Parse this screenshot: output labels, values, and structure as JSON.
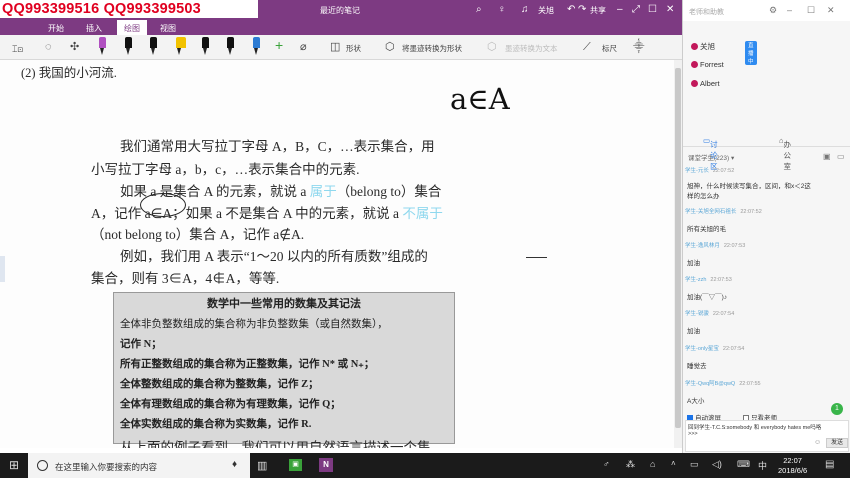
{
  "watermark": "QQ993399516  QQ993399503",
  "window": {
    "title": "最近的笔记",
    "user": "关旭",
    "share_label": "共享",
    "tabs": [
      "开始",
      "插入",
      "绘图",
      "视图"
    ],
    "active_tab": "绘图"
  },
  "ribbon": {
    "shape_label": "形状",
    "ink_to_shape_label": "将墨迹转换为形状",
    "ink_to_text_label": "墨迹转换为文本",
    "ruler_label": "标尺",
    "pen_colors": [
      "#b04fc0",
      "#111111",
      "#111111",
      "#f2c200",
      "#111111",
      "#111111",
      "#2b7bd3",
      "#111111",
      "#3aa23a"
    ]
  },
  "page": {
    "heading": "(2) 我国的小河流.",
    "handwriting": "a∈A",
    "para1_line1": "我们通常用大写拉丁字母 A，B，C，…表示集合，用",
    "para1_line2": "小写拉丁字母 a，b，c，…表示集合中的元素.",
    "para2_line1_a": "如果 a 是集合 A 的元素，就说 a ",
    "para2_line1_hl": "属于",
    "para2_line1_b": "（belong to）集合",
    "para2_line2_a": "A，记作 a∈A；如果 a 不是集合 A 中的元素，就说 a ",
    "para2_line2_hl": "不属于",
    "para2_line3": "（not belong to）集合 A，记作 a∉A.",
    "para3_line1": "例如，我们用 A 表示“1～20 以内的所有质数”组成的",
    "para3_line2": "集合，则有 3∈A，4∉A，等等.",
    "box": {
      "title": "数学中一些常用的数集及其记法",
      "lines": [
        "全体非负整数组成的集合称为非负整数集（或自然数集），",
        "记作 N；",
        "所有正整数组成的集合称为正整数集，记作 N* 或 N₊；",
        "全体整数组成的集合称为整数集，记作 Z；",
        "全体有理数组成的集合称为有理数集，记作 Q；",
        "全体实数组成的集合称为实数集，记作 R."
      ]
    },
    "last_line": "从上面的例子看到，我们可以用自然语言描述一个集"
  },
  "side_panel": {
    "search_placeholder": "老师和助教",
    "members": [
      {
        "name": "关旭",
        "badge": "直播中",
        "color": "#c2185b"
      },
      {
        "name": "Forrest",
        "badge": "",
        "color": "#c2185b"
      },
      {
        "name": "Albert",
        "badge": "",
        "color": "#c2185b"
      }
    ],
    "tab_discussion": "讨论区",
    "tab_office": "办公室",
    "class_label": "课堂学生(223)",
    "messages": [
      {
        "user": "学生-元长",
        "time": "22:07:52",
        "text": "旭神，什么时候读写集合，区间，和x＜2这",
        "text2": "样的怎么办"
      },
      {
        "user": "学生-关旭全网石祖长",
        "time": "22:07:52",
        "text": "所有关旭的毛",
        "text2": ""
      },
      {
        "user": "学生-逸风林月",
        "time": "22:07:53",
        "text": "加油",
        "text2": ""
      },
      {
        "user": "学生-zzh",
        "time": "22:07:53",
        "text": "加油(￣▽￣)♪",
        "text2": ""
      },
      {
        "user": "学生-锐骏",
        "time": "22:07:54",
        "text": "加油",
        "text2": ""
      },
      {
        "user": "学生-only星宝",
        "time": "22:07:54",
        "text": "睡觉去",
        "text2": ""
      },
      {
        "user": "学生-Qwq阿B@qwQ",
        "time": "22:07:55",
        "text": "A大小",
        "text2": ""
      }
    ],
    "auto_scroll": "自动滚屏",
    "only_teacher": "只看老师",
    "input_text": "回到学生-T.C.S:somebody 和 everybody hates me吗咯",
    "input_more": ">>>",
    "send_label": "发送",
    "badge_count": "1"
  },
  "taskbar": {
    "search_placeholder": "在这里输入你要搜索的内容",
    "time": "22:07",
    "date": "2018/6/6",
    "ime": "中"
  }
}
